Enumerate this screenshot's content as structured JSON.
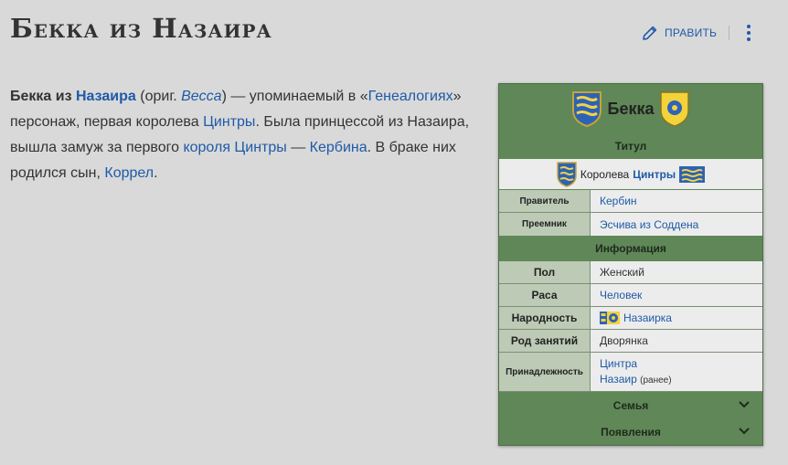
{
  "page": {
    "title": "Бекка из Назаира",
    "edit_label": "ПРАВИТЬ"
  },
  "intro": {
    "w1": "Бекка из",
    "link_nazair": "Назаира",
    "w2": "(ориг.",
    "orig": "Becca",
    "w3": ") — упоминаемый в «",
    "link_genealogies": "Генеалогиях",
    "w4": "» персонаж, первая королева",
    "link_cintra": "Цинтры",
    "w5": ". Была принцессой из Назаира, вышла замуж за первого",
    "link_king": "короля Цинтры",
    "w6": "—",
    "link_kerbin": "Кербина",
    "w7": ". В браке них родился сын,",
    "link_korrel": "Коррел",
    "w8": "."
  },
  "infobox": {
    "name": "Бекка",
    "section_title": "Титул",
    "title_prefix": "Королева",
    "title_link": "Цинтры",
    "rows_title": [
      {
        "label": "Правитель",
        "value": "Кербин"
      },
      {
        "label": "Преемник",
        "value": "Эсчива из Содденa"
      }
    ],
    "section_info": "Информация",
    "gender": {
      "label": "Пол",
      "value": "Женский"
    },
    "race": {
      "label": "Раса",
      "value": "Человек"
    },
    "nationality": {
      "label": "Народность",
      "value": "Назаирка"
    },
    "occupation": {
      "label": "Род занятий",
      "value": "Дворянка"
    },
    "affiliation": {
      "label": "Принадлежность",
      "value1": "Цинтра",
      "value2": "Назаир",
      "note": "(ранее)"
    },
    "family": "Семья",
    "appearances": "Появления"
  },
  "colors": {
    "link": "#1e5aa8",
    "infobox_green": "#5f8757",
    "label_bg": "#bdcab6",
    "value_bg": "#ececec"
  }
}
